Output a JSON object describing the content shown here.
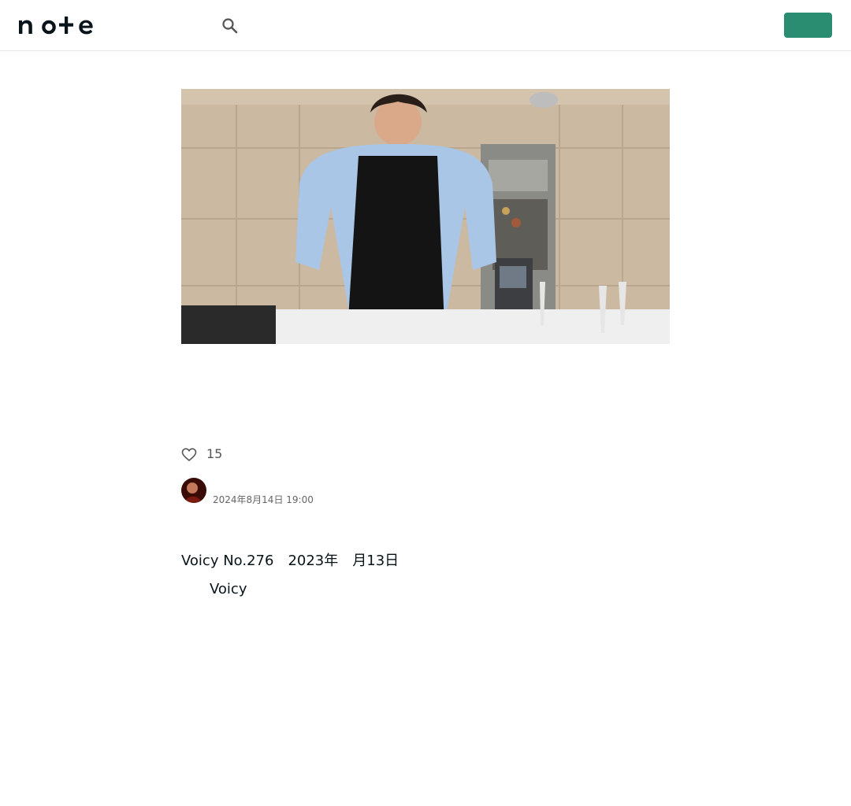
{
  "header": {
    "brand": "note",
    "search_icon": "search-icon",
    "login_label": "",
    "signup_label": "",
    "accent_color": "#2a8c70"
  },
  "hero": {
    "image": "photo of a man in a light blue shirt and black apron, hands on hips, in a tiled restaurant kitchen with wine glasses on a table"
  },
  "article": {
    "title": "",
    "like_icon": "heart-outline-icon",
    "like_count": "15",
    "author_name": "",
    "date": "2024年8月14日 19:00",
    "body": {
      "line1": "Voicy No.276　2023年　月13日　",
      "line2_before_link": "　　Voicy　　　　　　　",
      "line2_link": "",
      "line2_after_link": "",
      "paragraph": ""
    }
  }
}
